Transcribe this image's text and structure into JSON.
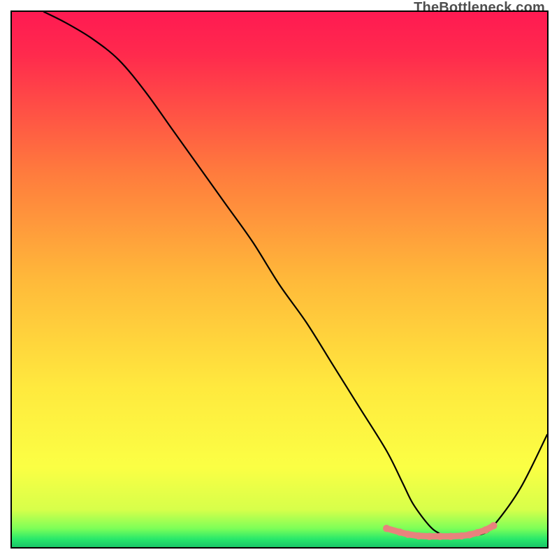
{
  "watermark": "TheBottleneck.com",
  "chart_data": {
    "type": "line",
    "title": "",
    "xlabel": "",
    "ylabel": "",
    "xlim": [
      0,
      100
    ],
    "ylim": [
      0,
      100
    ],
    "grid": false,
    "series": [
      {
        "name": "curve",
        "x": [
          6,
          10,
          15,
          20,
          25,
          30,
          35,
          40,
          45,
          50,
          55,
          60,
          65,
          70,
          73,
          75,
          78,
          80,
          82,
          85,
          88,
          90,
          95,
          100
        ],
        "y": [
          100,
          98,
          95,
          91,
          85,
          78,
          71,
          64,
          57,
          49,
          42,
          34,
          26,
          18,
          12,
          8,
          4,
          2.5,
          2,
          2,
          2.5,
          4,
          11,
          21
        ]
      }
    ],
    "highlight": {
      "name": "valley-dots",
      "x": [
        70,
        72.5,
        74,
        76,
        78,
        80,
        82,
        84,
        85.5,
        87,
        88.5,
        90
      ],
      "y": [
        3.5,
        2.8,
        2.4,
        2.1,
        2.0,
        2.0,
        2.0,
        2.1,
        2.3,
        2.7,
        3.2,
        4.0
      ]
    },
    "gradient_stops": [
      {
        "offset": 0.0,
        "color": "#ff1a52"
      },
      {
        "offset": 0.08,
        "color": "#ff2a4d"
      },
      {
        "offset": 0.3,
        "color": "#ff7b3d"
      },
      {
        "offset": 0.5,
        "color": "#ffb93a"
      },
      {
        "offset": 0.7,
        "color": "#ffe93e"
      },
      {
        "offset": 0.85,
        "color": "#fbff44"
      },
      {
        "offset": 0.93,
        "color": "#d7ff4a"
      },
      {
        "offset": 0.965,
        "color": "#7dff58"
      },
      {
        "offset": 0.985,
        "color": "#28e86b"
      },
      {
        "offset": 1.0,
        "color": "#19c668"
      }
    ]
  }
}
